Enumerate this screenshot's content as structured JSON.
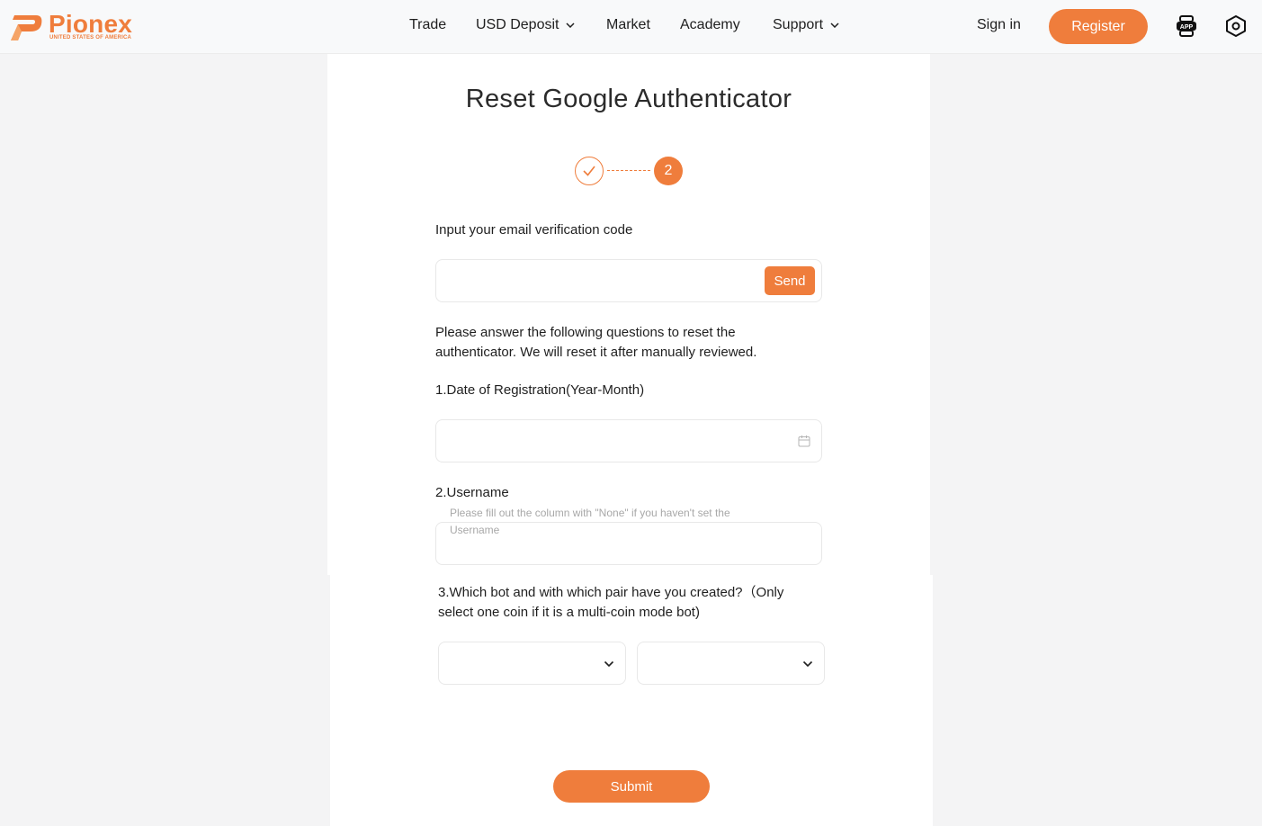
{
  "brand": {
    "name": "Pionex",
    "subtitle": "UNITED STATES OF AMERICA",
    "accent_color": "#ef7d3c"
  },
  "nav": {
    "items": [
      {
        "label": "Trade",
        "has_dropdown": false
      },
      {
        "label": "USD Deposit",
        "has_dropdown": true
      },
      {
        "label": "Market",
        "has_dropdown": false
      },
      {
        "label": "Academy",
        "has_dropdown": false
      },
      {
        "label": "Support",
        "has_dropdown": true
      }
    ],
    "sign_in": "Sign in",
    "register": "Register",
    "icons": [
      "app-download-icon",
      "settings-hexagon-icon"
    ],
    "app_badge": "APP"
  },
  "page": {
    "title": "Reset Google Authenticator",
    "stepper": {
      "completed_step": "check",
      "current_step": "2"
    }
  },
  "form": {
    "email_code_label": "Input your email verification code",
    "email_code_value": "",
    "send_label": "Send",
    "intro_line1": "Please answer the following questions to reset the",
    "intro_line2": "authenticator. We will reset it after manually reviewed.",
    "q1_label": "1.Date of Registration(Year-Month)",
    "q1_value": "",
    "q2_label": "2.Username",
    "q2_placeholder_line1": "Please fill out the column with \"None\" if you haven't set the",
    "q2_placeholder_line2": "Username",
    "q3_label_line1": "3.Which bot and with which pair have you created?（Only",
    "q3_label_line2": "select one coin if it is a multi-coin mode bot)",
    "q3_bot_value": "",
    "q3_pair_value": "",
    "submit_label": "Submit"
  }
}
